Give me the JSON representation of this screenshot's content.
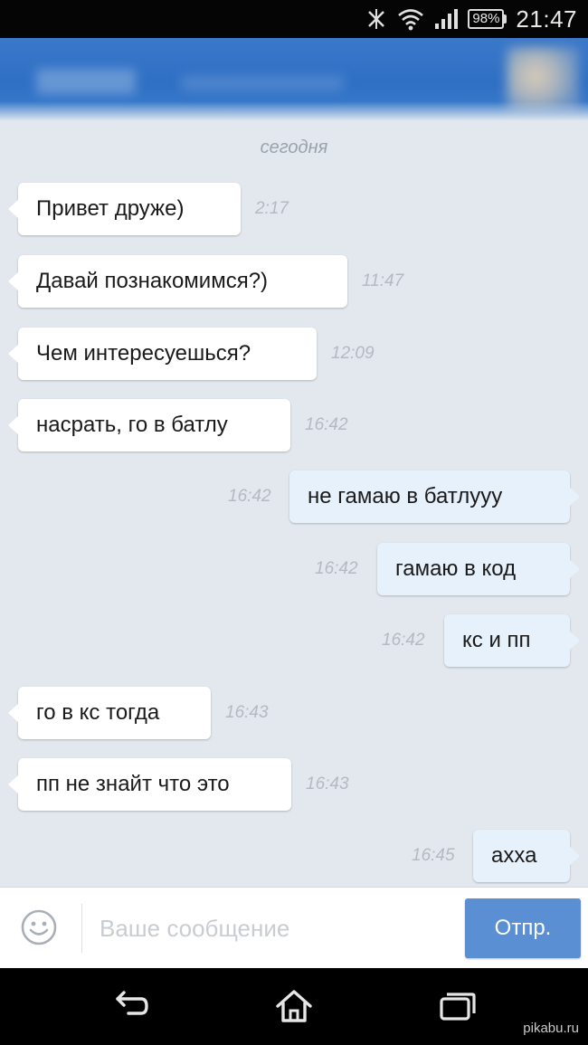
{
  "status_bar": {
    "battery": "98%",
    "time": "21:47"
  },
  "icons": {
    "vibrate": "vibrate-icon",
    "wifi": "wifi-icon",
    "signal": "signal-icon",
    "battery": "battery-icon",
    "smiley": "smiley-icon",
    "back": "back-icon",
    "home": "home-icon",
    "recents": "recent-apps-icon"
  },
  "chat": {
    "date_label": "сегодня",
    "messages": [
      {
        "direction": "in",
        "text": "Привет друже)",
        "time": "2:17"
      },
      {
        "direction": "in",
        "text": "Давай познакомимся?)",
        "time": "11:47"
      },
      {
        "direction": "in",
        "text": "Чем интересуешься?",
        "time": "12:09"
      },
      {
        "direction": "in",
        "text": "насрать, го в батлу",
        "time": "16:42"
      },
      {
        "direction": "out",
        "text": "не гамаю в батлууу",
        "time": "16:42"
      },
      {
        "direction": "out",
        "text": "гамаю в код",
        "time": "16:42"
      },
      {
        "direction": "out",
        "text": "кс и пп",
        "time": "16:42"
      },
      {
        "direction": "in",
        "text": "го в кс тогда",
        "time": "16:43"
      },
      {
        "direction": "in",
        "text": "пп не знайт что это",
        "time": "16:43"
      },
      {
        "direction": "out",
        "text": "ахха",
        "time": "16:45"
      }
    ]
  },
  "composer": {
    "placeholder": "Ваше сообщение",
    "send_label": "Отпр."
  },
  "watermark": "pikabu.ru",
  "colors": {
    "header": "#3a78c9",
    "chat_background": "#e3e8ee",
    "incoming_bubble": "#ffffff",
    "outgoing_bubble": "#e7f1fb",
    "send_button": "#5a8fd3"
  }
}
